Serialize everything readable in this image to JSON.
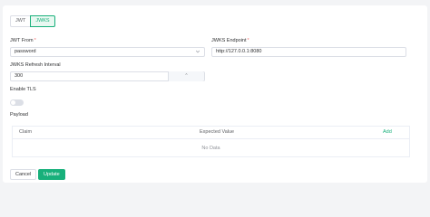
{
  "tabs": [
    {
      "label": "JWT",
      "active": false
    },
    {
      "label": "JWKS",
      "active": true
    }
  ],
  "fields": {
    "jwt_from": {
      "label": "JWT From",
      "required": "*",
      "value": "password",
      "icon": "chevron-down-icon"
    },
    "jwks_endpoint": {
      "label": "JWKS Endpoint",
      "required": "*",
      "value": "http://127.0.0.1:8080"
    },
    "refresh_interval": {
      "label": "JWKS Refresh Interval",
      "value": "300",
      "stepper_symbol": "⌃"
    },
    "enable_tls": {
      "label": "Enable TLS",
      "enabled": false
    }
  },
  "payload": {
    "label": "Payload",
    "columns": {
      "claim": "Claim",
      "expected_value": "Expected Value"
    },
    "add_label": "Add",
    "empty_text": "No Data"
  },
  "actions": {
    "cancel": "Cancel",
    "update": "Update"
  },
  "colors": {
    "accent": "#18b07b",
    "required": "#f56c6c"
  }
}
